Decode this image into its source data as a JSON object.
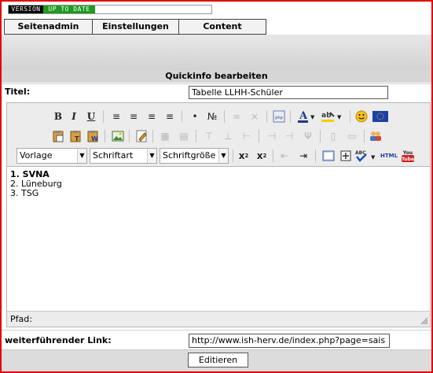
{
  "version_badge": {
    "label": "VERSION",
    "status": "UP TO DATE"
  },
  "nav": {
    "tabs": [
      {
        "label": "Seitenadmin"
      },
      {
        "label": "Einstellungen"
      },
      {
        "label": "Content"
      }
    ]
  },
  "section_title": "Quickinfo bearbeiten",
  "title_field": {
    "label": "Titel:",
    "value": "Tabelle LLHH-Schüler"
  },
  "editor": {
    "toolbar": {
      "format_select": "Vorlage",
      "font_select": "Schriftart",
      "size_select": "Schriftgröße",
      "html_button": "HTML",
      "youtube_button": "You Tube",
      "php_button": "php",
      "abc_button": "ABC"
    },
    "content": [
      "1. SVNA",
      "2. Lüneburg",
      "3. TSG"
    ],
    "path_label": "Pfad:"
  },
  "link_field": {
    "label": "weiterführender Link:",
    "value": "http://www.ish-herv.de/index.php?page=sais"
  },
  "submit_label": "Editieren",
  "colors": {
    "frame": "#e30000",
    "badge_green": "#1f9a22",
    "badge_black": "#000000"
  }
}
